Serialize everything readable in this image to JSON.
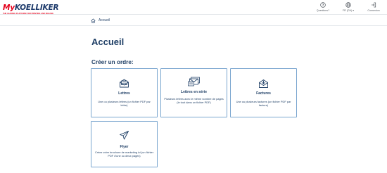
{
  "header": {
    "logo_my": "My",
    "logo_brand": "KOELLIKER",
    "logo_tagline": "THE LEADING PLATFORM FOR PRINTING AND MAILING",
    "actions": [
      {
        "label": "Questions?",
        "icon": "question-icon"
      },
      {
        "label": "FR (CH) ▾",
        "icon": "globe-icon"
      },
      {
        "label": "Connexion",
        "icon": "login-icon"
      }
    ]
  },
  "breadcrumb": {
    "label": "Accueil",
    "icon": "home-icon"
  },
  "page": {
    "title": "Accueil",
    "section_title": "Créer un ordre:"
  },
  "cards": [
    {
      "title": "Lettres",
      "description": "Une ou plusieurs lettres (un fichier PDF par lettre)",
      "icon": "letter-icon"
    },
    {
      "title": "Lettres en série",
      "description": "Plusieurs lettres avec le même nombre de pages (le tout dans un fichier PDF)",
      "icon": "serial-letters-icon"
    },
    {
      "title": "Factures",
      "description": "Une ou plusieurs factures (un fichier PDF par facture)",
      "icon": "invoice-icon"
    },
    {
      "title": "Flyer",
      "description": "Créez votre brochure de marketing ici (un fichier PDF d'une ou deux pages)",
      "icon": "paper-plane-icon"
    }
  ],
  "colors": {
    "brand_red": "#e3001b",
    "brand_navy": "#1d3a6b",
    "text": "#1f3f66",
    "card_border": "#7aa6cf"
  }
}
